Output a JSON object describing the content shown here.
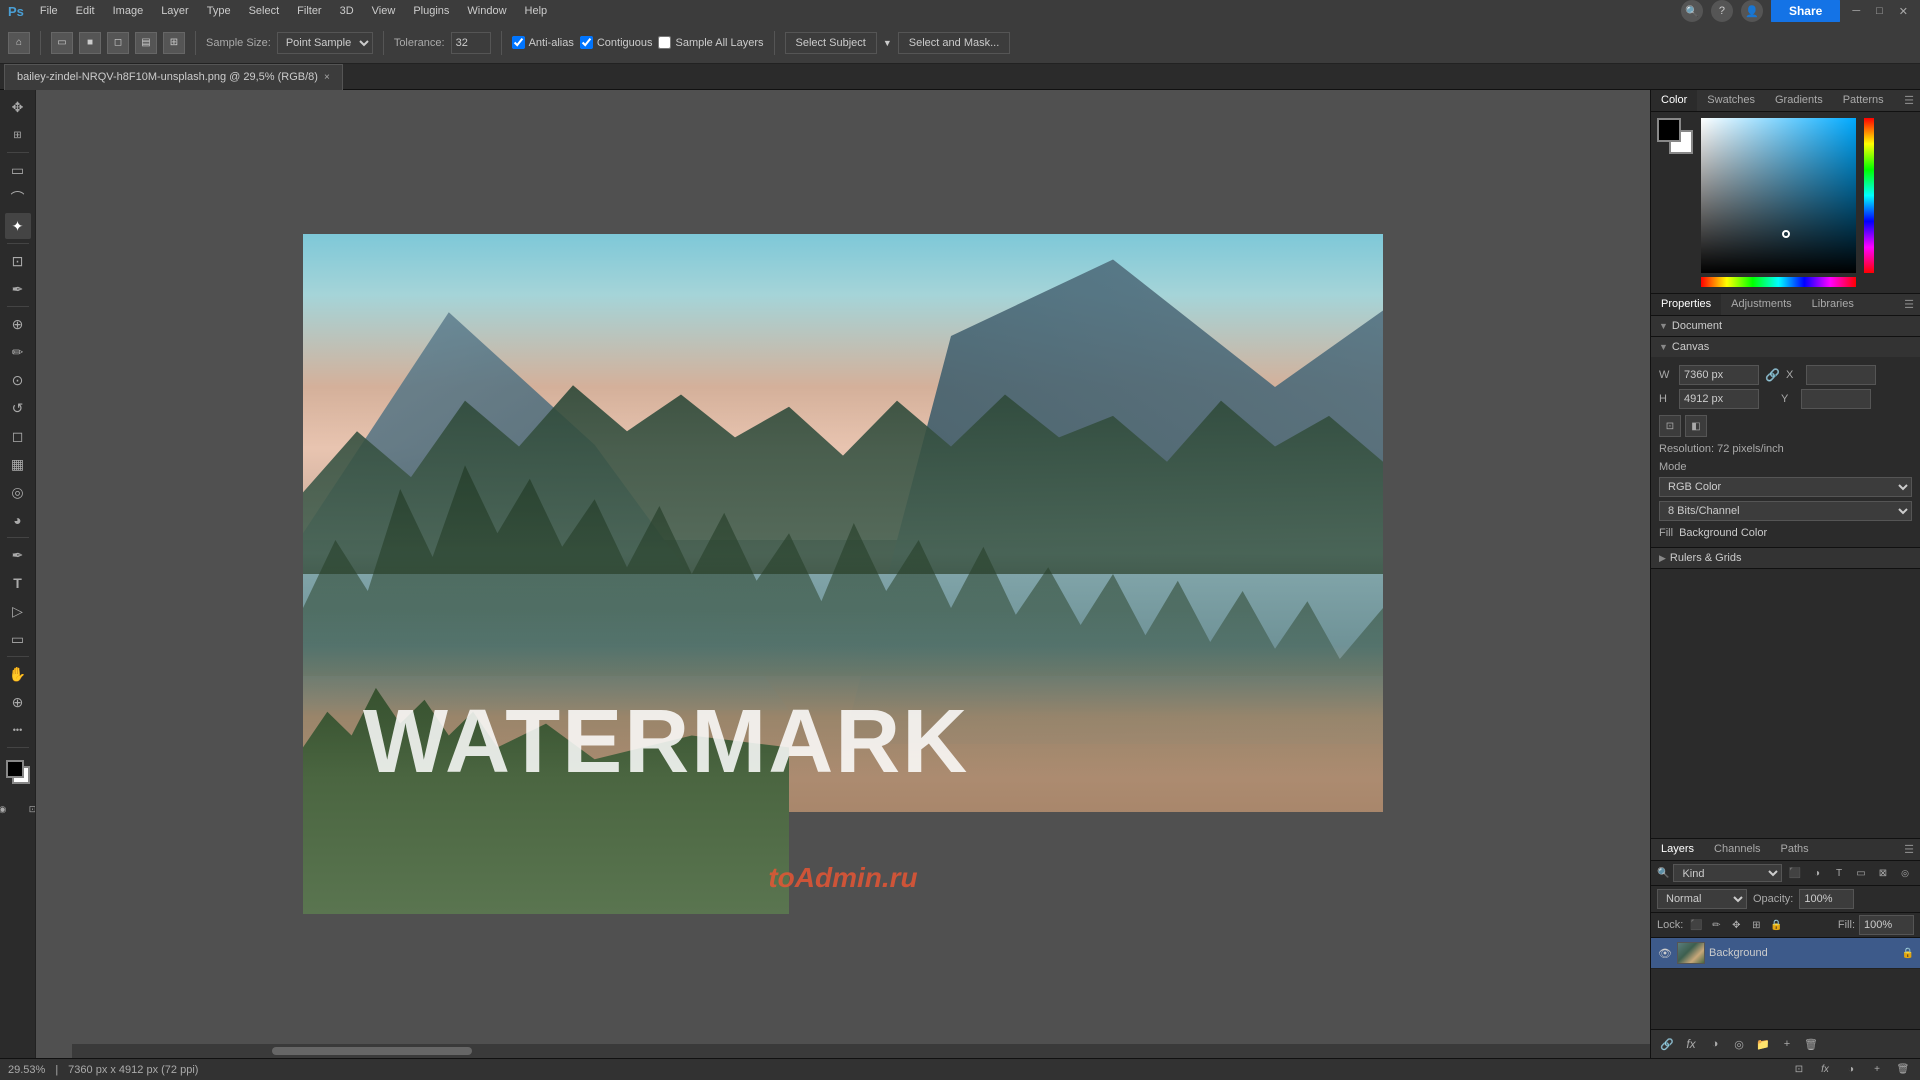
{
  "app": {
    "title": "Adobe Photoshop"
  },
  "menu": {
    "items": [
      "File",
      "Edit",
      "Image",
      "Layer",
      "Type",
      "Select",
      "Filter",
      "3D",
      "View",
      "Plugins",
      "Window",
      "Help"
    ]
  },
  "toolbar": {
    "sample_size_label": "Sample Size:",
    "sample_size_value": "Point Sample",
    "tolerance_label": "Tolerance:",
    "tolerance_value": "32",
    "anti_alias_label": "Anti-alias",
    "contiguous_label": "Contiguous",
    "sample_all_layers_label": "Sample All Layers",
    "select_subject_btn": "Select Subject",
    "select_mask_btn": "Select and Mask...",
    "share_btn": "Share"
  },
  "tab": {
    "filename": "bailey-zindel-NRQV-h8F10M-unsplash.png @ 29,5% (RGB/8)",
    "close": "×"
  },
  "color_panel": {
    "tabs": [
      "Color",
      "Swatches",
      "Gradients",
      "Patterns"
    ],
    "active_tab": "Color"
  },
  "swatches_panel": {
    "tab_label": "Swatches"
  },
  "properties_panel": {
    "tabs": [
      "Properties",
      "Adjustments",
      "Libraries"
    ],
    "active_tab": "Properties",
    "document_label": "Document",
    "canvas_label": "Canvas",
    "w_label": "W",
    "h_label": "H",
    "x_label": "X",
    "y_label": "Y",
    "w_value": "7360 px",
    "h_value": "4912 px",
    "x_value": "",
    "y_value": "",
    "resolution_label": "Resolution:",
    "resolution_value": "72 pixels/inch",
    "mode_label": "Mode",
    "mode_value": "RGB Color",
    "bits_value": "8 Bits/Channel",
    "fill_label": "Fill",
    "fill_value": "Background Color",
    "rulers_grids_label": "Rulers & Grids"
  },
  "layers_panel": {
    "tabs": [
      "Layers",
      "Channels",
      "Paths"
    ],
    "active_tab": "Layers",
    "search_placeholder": "Kind",
    "blend_mode": "Normal",
    "opacity_label": "Opacity:",
    "opacity_value": "100%",
    "fill_label": "Fill:",
    "fill_value": "100%",
    "layers": [
      {
        "name": "Background",
        "visible": true,
        "locked": true,
        "selected": true
      }
    ]
  },
  "canvas": {
    "watermark": "WATERMARK",
    "toadmin": "toAdmin.ru",
    "zoom": "29.53%",
    "dimensions": "7360 px x 4912 px (72 ppi)"
  },
  "icons": {
    "move": "✥",
    "select_rect": "▭",
    "lasso": "⌐",
    "magic_wand": "✦",
    "crop": "⊞",
    "eyedropper": "✒",
    "healing": "⊕",
    "brush": "✏",
    "clone": "⊙",
    "eraser": "◻",
    "gradient": "▦",
    "dodge": "◕",
    "pen": "✒",
    "type": "T",
    "path": "▷",
    "shape": "▭",
    "hand": "✋",
    "zoom": "⊕",
    "more": "...",
    "fg_bg": "◼",
    "fg_bg2": "◻",
    "eye": "👁",
    "lock": "🔒",
    "new_layer": "+",
    "delete_layer": "🗑",
    "fx": "fx",
    "adjustment": "◑",
    "folder": "📁",
    "link": "🔗"
  }
}
